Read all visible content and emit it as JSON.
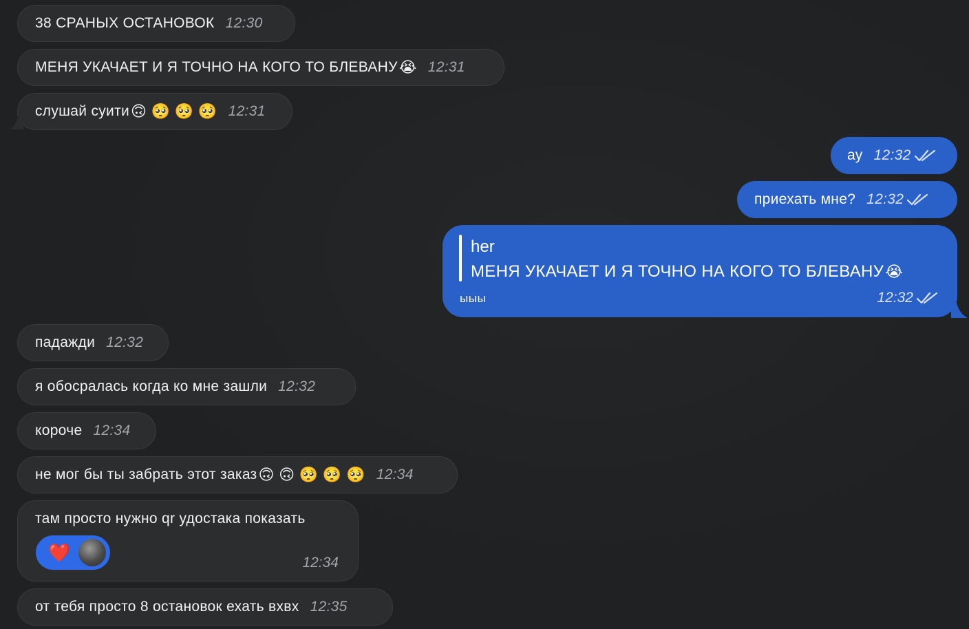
{
  "messages_in_top": [
    {
      "text": "38 СРАНЫХ ОСТАНОВОК",
      "time": "12:30",
      "emoji": ""
    },
    {
      "text": "МЕНЯ УКАЧАЕТ И Я ТОЧНО НА КОГО ТО БЛЕВАНУ",
      "time": "12:31",
      "emoji": "😭"
    },
    {
      "text": "слушай суити",
      "time": "12:31",
      "emoji": "🙃 🥺 🥺 🥺"
    }
  ],
  "messages_out": [
    {
      "text": "ау",
      "time": "12:32"
    },
    {
      "text": "приехать мне?",
      "time": "12:32"
    }
  ],
  "reply": {
    "author": "her",
    "quoted_text": "МЕНЯ УКАЧАЕТ И Я ТОЧНО НА КОГО ТО БЛЕВАНУ",
    "quoted_emoji": "😭",
    "text": "ыыы",
    "time": "12:32"
  },
  "messages_in_bottom": [
    {
      "text": "падажди",
      "time": "12:32",
      "emoji": ""
    },
    {
      "text": "я обосралась когда ко мне зашли",
      "time": "12:32",
      "emoji": ""
    },
    {
      "text": "короче",
      "time": "12:34",
      "emoji": ""
    },
    {
      "text": "не мог бы ты забрать этот заказ",
      "time": "12:34",
      "emoji": "🙃 🙃 🥺 🥺 🥺"
    }
  ],
  "reaction_message": {
    "text": "там просто нужно qr удостака показать",
    "time": "12:34",
    "reaction": "❤️"
  },
  "last_message": {
    "text": "от тебя просто 8 остановок ехать вхвх",
    "time": "12:35"
  },
  "colors": {
    "background": "#1f2123",
    "incoming_bubble": "#2c2d2f",
    "outgoing_bubble": "#2a61c9",
    "reaction_pill": "#2e6ae8"
  }
}
